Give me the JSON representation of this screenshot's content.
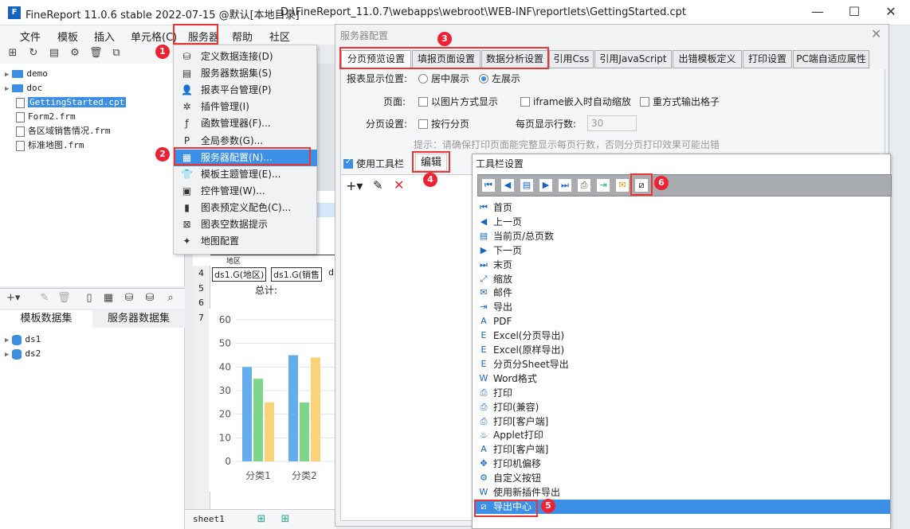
{
  "app": {
    "logo": "F",
    "title": "FineReport 11.0.6 stable 2022-07-15 @默认[本地目录]",
    "path": "D:\\FineReport_11.0.7\\webapps\\webroot\\WEB-INF\\reportlets\\GettingStarted.cpt"
  },
  "menu": [
    "文件",
    "模板",
    "插入",
    "单元格(C)",
    "服务器",
    "帮助",
    "社区"
  ],
  "tree": [
    {
      "label": "demo",
      "type": "folder"
    },
    {
      "label": "doc",
      "type": "folder"
    },
    {
      "label": "GettingStarted.cpt",
      "type": "file",
      "selected": true
    },
    {
      "label": "Form2.frm",
      "type": "file"
    },
    {
      "label": "各区域销售情况.frm",
      "type": "file"
    },
    {
      "label": "标准地图.frm",
      "type": "file"
    }
  ],
  "dataset_tabs": [
    "模板数据集",
    "服务器数据集"
  ],
  "datasets": [
    "ds1",
    "ds2"
  ],
  "dropdown": [
    {
      "label": "定义数据连接(D)",
      "icon": "db-connection-icon",
      "glyph": "⛁"
    },
    {
      "label": "服务器数据集(S)",
      "icon": "dataset-icon",
      "glyph": "▤"
    },
    {
      "label": "报表平台管理(P)",
      "icon": "user-icon",
      "glyph": "👤"
    },
    {
      "label": "插件管理(I)",
      "icon": "plugin-icon",
      "glyph": "✲"
    },
    {
      "label": "函数管理器(F)...",
      "icon": "function-icon",
      "glyph": "ƒ"
    },
    {
      "label": "全局参数(G)...",
      "icon": "param-icon",
      "glyph": "P"
    },
    {
      "label": "服务器配置(N)...",
      "icon": "server-config-icon",
      "glyph": "▦",
      "highlight": true
    },
    {
      "label": "模板主题管理(E)...",
      "icon": "theme-icon",
      "glyph": "👕"
    },
    {
      "label": "控件管理(W)...",
      "icon": "widget-icon",
      "glyph": "▣"
    },
    {
      "label": "图表预定义配色(C)...",
      "icon": "chart-color-icon",
      "glyph": "▮"
    },
    {
      "label": "图表空数据提示",
      "icon": "empty-chart-icon",
      "glyph": "⊠"
    },
    {
      "label": "地图配置",
      "icon": "map-icon",
      "glyph": "✦"
    }
  ],
  "dialog": {
    "title": "服务器配置",
    "tabs": [
      "分页预览设置",
      "填报页面设置",
      "数据分析设置",
      "引用Css",
      "引用JavaScript",
      "出错模板定义",
      "打印设置",
      "PC端自适应属性"
    ],
    "display_label": "报表显示位置:",
    "display_options": [
      "居中展示",
      "左展示"
    ],
    "page_label": "页面:",
    "page_options": [
      "以图片方式显示",
      "iframe嵌入时自动缩放",
      "重方式输出格子"
    ],
    "paging_label": "分页设置:",
    "paging_option": "按行分页",
    "rows_label": "每页显示行数:",
    "rows_value": "30",
    "hint": "提示：请确保打印页面能完整显示每页行数，否则分页打印效果可能出错",
    "use_toolbar": "使用工具栏",
    "edit_btn": "编辑"
  },
  "toolbar_settings": {
    "title": "工具栏设置",
    "items": [
      {
        "label": "首页",
        "icon": "first-page-icon",
        "glyph": "⏮"
      },
      {
        "label": "上一页",
        "icon": "prev-page-icon",
        "glyph": "◀"
      },
      {
        "label": "当前页/总页数",
        "icon": "page-count-icon",
        "glyph": "▤"
      },
      {
        "label": "下一页",
        "icon": "next-page-icon",
        "glyph": "▶"
      },
      {
        "label": "末页",
        "icon": "last-page-icon",
        "glyph": "⏭"
      },
      {
        "label": "缩放",
        "icon": "zoom-icon",
        "glyph": "⤢"
      },
      {
        "label": "邮件",
        "icon": "mail-icon",
        "glyph": "✉"
      },
      {
        "label": "导出",
        "icon": "export-icon",
        "glyph": "⇥"
      },
      {
        "label": "PDF",
        "icon": "pdf-icon",
        "glyph": "A"
      },
      {
        "label": "Excel(分页导出)",
        "icon": "excel-page-icon",
        "glyph": "E"
      },
      {
        "label": "Excel(原样导出)",
        "icon": "excel-raw-icon",
        "glyph": "E"
      },
      {
        "label": "分页分Sheet导出",
        "icon": "excel-sheet-icon",
        "glyph": "E"
      },
      {
        "label": "Word格式",
        "icon": "word-icon",
        "glyph": "W"
      },
      {
        "label": "打印",
        "icon": "print-icon",
        "glyph": "⎙"
      },
      {
        "label": "打印(兼容)",
        "icon": "print-compat-icon",
        "glyph": "⎙"
      },
      {
        "label": "打印[客户端]",
        "icon": "print-client-icon",
        "glyph": "⎙"
      },
      {
        "label": "Applet打印",
        "icon": "applet-print-icon",
        "glyph": "♨"
      },
      {
        "label": "打印[客户端]",
        "icon": "print-client-icon-2",
        "glyph": "A"
      },
      {
        "label": "打印机偏移",
        "icon": "printer-offset-icon",
        "glyph": "✥"
      },
      {
        "label": "自定义按钮",
        "icon": "custom-button-icon",
        "glyph": "⚙"
      },
      {
        "label": "使用新插件导出",
        "icon": "new-plugin-export-icon",
        "glyph": "W"
      },
      {
        "label": "导出中心",
        "icon": "export-center-icon",
        "glyph": "⧄",
        "selected": true
      }
    ]
  },
  "sheet": {
    "rows": [
      "4",
      "5",
      "6",
      "7"
    ],
    "cells": [
      "ds1.G(地区)",
      "ds1.G(销售",
      "d"
    ],
    "total_label": "总计:",
    "header_snippet": "地区"
  },
  "bottom": {
    "sheet_tab": "sheet1"
  },
  "badges": [
    "1",
    "2",
    "3",
    "4",
    "5",
    "6"
  ],
  "chart_data": {
    "type": "bar",
    "categories": [
      "分类1",
      "分类2"
    ],
    "series": [
      {
        "values": [
          40,
          45
        ],
        "color": "#64aef0"
      },
      {
        "values": [
          35,
          25
        ],
        "color": "#7ed68a"
      },
      {
        "values": [
          25,
          44
        ],
        "color": "#f9d27a"
      }
    ],
    "ylim": [
      0,
      60
    ],
    "yticks": [
      0,
      10,
      20,
      30,
      40,
      50,
      60
    ]
  },
  "colors": {
    "accent": "#3c8fe6",
    "highlight_red": "#e23333"
  }
}
